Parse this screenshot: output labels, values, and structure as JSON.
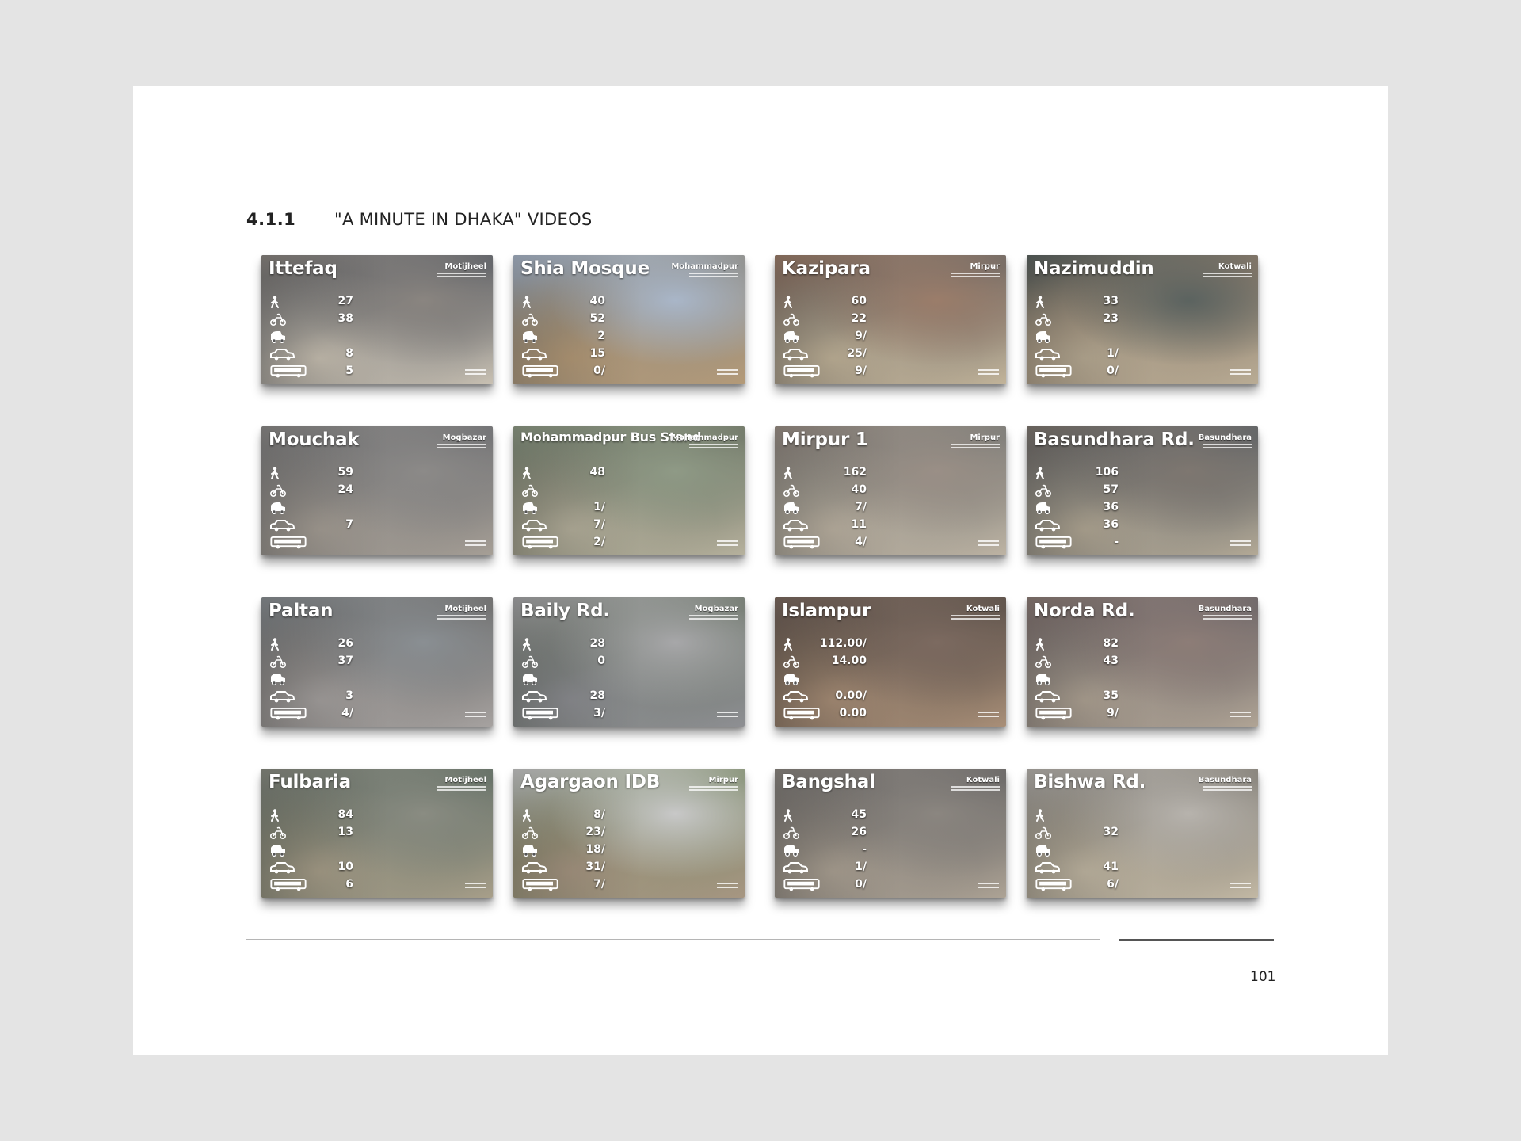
{
  "section": {
    "number": "4.1.1",
    "title": "\"A MINUTE IN DHAKA\" VIDEOS"
  },
  "page_number": "101",
  "icon_legend": [
    "pedestrian-icon",
    "rickshaw-icon",
    "cng-autorickshaw-icon",
    "car-icon",
    "bus-icon"
  ],
  "tiles": [
    {
      "name": "Ittefaq",
      "area": "Motijheel",
      "values": [
        "27",
        "38",
        "",
        "8",
        "5"
      ],
      "tone": [
        "#8a8580",
        "#5b5f66",
        "#c9c1b3"
      ]
    },
    {
      "name": "Shia Mosque",
      "area": "Mohammadpur",
      "values": [
        "40",
        "52",
        "2",
        "15",
        "0/"
      ],
      "tone": [
        "#a9b6c8",
        "#8d8a82",
        "#b49a78"
      ]
    },
    {
      "name": "Kazipara",
      "area": "Mirpur",
      "values": [
        "60",
        "22",
        "9/",
        "25/",
        "9/"
      ],
      "tone": [
        "#9b7d6a",
        "#6f6a66",
        "#c2b49a"
      ]
    },
    {
      "name": "Nazimuddin",
      "area": "Kotwali",
      "values": [
        "33",
        "23",
        "",
        "1/",
        "0/"
      ],
      "tone": [
        "#5b6360",
        "#8a7a6a",
        "#b9ac95"
      ]
    },
    {
      "name": "Mouchak",
      "area": "Mogbazar",
      "values": [
        "59",
        "24",
        "",
        "7",
        ""
      ],
      "tone": [
        "#8c8a88",
        "#6e6f72",
        "#a69f96"
      ]
    },
    {
      "name": "Mohammadpur Bus Stand",
      "area": "Mohammadpur",
      "values": [
        "48",
        "",
        "1/",
        "7/",
        "2/"
      ],
      "tone": [
        "#8f9a86",
        "#6e7465",
        "#b6b19d"
      ]
    },
    {
      "name": "Mirpur 1",
      "area": "Mirpur",
      "values": [
        "162",
        "40",
        "7/",
        "11",
        "4/"
      ],
      "tone": [
        "#9a8f86",
        "#7b7c78",
        "#bdb3a3"
      ]
    },
    {
      "name": "Basundhara Rd.",
      "area": "Basundhara",
      "values": [
        "106",
        "57",
        "36",
        "36",
        "-"
      ],
      "tone": [
        "#7e7770",
        "#5e6266",
        "#b3a996"
      ]
    },
    {
      "name": "Paltan",
      "area": "Motijheel",
      "values": [
        "26",
        "37",
        "",
        "3",
        "4/"
      ],
      "tone": [
        "#8a8f93",
        "#6c6a68",
        "#a6a2a0"
      ]
    },
    {
      "name": "Baily Rd.",
      "area": "Mogbazar",
      "values": [
        "28",
        "0",
        "",
        "28",
        "3/"
      ],
      "tone": [
        "#a7a7a9",
        "#6b7468",
        "#8e8f93"
      ]
    },
    {
      "name": "Islampur",
      "area": "Kotwali",
      "values": [
        "112.00/",
        "14.00",
        "",
        "0.00/",
        "0.00"
      ],
      "tone": [
        "#7c6a60",
        "#5a5048",
        "#a98f78"
      ]
    },
    {
      "name": "Norda Rd.",
      "area": "Basundhara",
      "values": [
        "82",
        "43",
        "",
        "35",
        "9/"
      ],
      "tone": [
        "#8d7d77",
        "#6a6568",
        "#b0a495"
      ]
    },
    {
      "name": "Fulbaria",
      "area": "Motijheel",
      "values": [
        "84",
        "13",
        "",
        "10",
        "6"
      ],
      "tone": [
        "#8a8c82",
        "#5f6c62",
        "#a89f8a"
      ]
    },
    {
      "name": "Agargaon IDB",
      "area": "Mirpur",
      "values": [
        "8/",
        "23/",
        "18/",
        "31/",
        "7/"
      ],
      "tone": [
        "#c8c8c8",
        "#7d8a6a",
        "#a79682"
      ]
    },
    {
      "name": "Bangshal",
      "area": "Kotwali",
      "values": [
        "45",
        "26",
        "-",
        "1/",
        "0/"
      ],
      "tone": [
        "#8b8680",
        "#666464",
        "#ada395"
      ]
    },
    {
      "name": "Bishwa Rd.",
      "area": "Basundhara",
      "values": [
        "",
        "32",
        "",
        "41",
        "6/"
      ],
      "tone": [
        "#b7b3ad",
        "#7e7a72",
        "#c2b8a4"
      ]
    }
  ]
}
